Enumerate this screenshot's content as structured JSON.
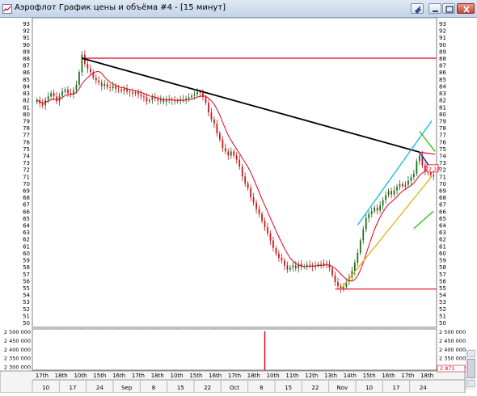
{
  "window": {
    "title": "Аэрофлот График цены и объёма #4 - [15 минут]"
  },
  "colors": {
    "candle_up": "#1a6b1a",
    "candle_down": "#c81414",
    "moving_average": "#e0001c",
    "trendline_black": "#000000",
    "resistance_red": "#e0001c",
    "channel_cyan": "#12b8d8",
    "trend_orange": "#e3b017",
    "fan_blue": "#1632c8",
    "fan_green": "#3bc01e",
    "volume_bar": "#e0001c",
    "grid": "#b4b4b4"
  },
  "chart_data": [
    {
      "type": "candlestick",
      "name": "price",
      "y_ticks": [
        "50",
        "51",
        "52",
        "53",
        "54",
        "55",
        "56",
        "57",
        "58",
        "59",
        "60",
        "61",
        "62",
        "63",
        "64",
        "65",
        "66",
        "67",
        "68",
        "69",
        "70",
        "71",
        "72",
        "73",
        "74",
        "75",
        "76",
        "77",
        "78",
        "79",
        "80",
        "81",
        "82",
        "83",
        "84",
        "85",
        "86",
        "87",
        "88",
        "89",
        "90",
        "91",
        "92",
        "93"
      ],
      "ylim": [
        50,
        93
      ],
      "x_top_labels": [
        "17th",
        "18th",
        "10th",
        "15th",
        "16th",
        "17th",
        "18th",
        "10th",
        "15th",
        "16th",
        "17th",
        "18th",
        "10th",
        "11th",
        "12th",
        "13th",
        "14th",
        "15th",
        "16th",
        "17th",
        "18th"
      ],
      "x_bottom_labels": [
        "10",
        "17",
        "24",
        "Sep",
        "8",
        "15",
        "22",
        "Oct",
        "8",
        "15",
        "22",
        "Nov",
        "10",
        "17",
        "24"
      ],
      "close_series": [
        82.0,
        81.5,
        81.2,
        82.0,
        82.5,
        83.0,
        82.5,
        81.8,
        82.6,
        83.2,
        83.5,
        83.0,
        82.8,
        83.4,
        84.2,
        86.0,
        88.5,
        87.2,
        86.5,
        86.0,
        85.2,
        84.8,
        84.5,
        84.0,
        84.3,
        83.8,
        83.7,
        84.0,
        83.6,
        83.5,
        83.3,
        83.6,
        83.2,
        83.1,
        82.9,
        83.1,
        82.8,
        82.5,
        82.4,
        81.8,
        82.0,
        82.4,
        82.2,
        81.9,
        82.1,
        81.7,
        82.1,
        81.9,
        82.0,
        81.8,
        81.9,
        82.1,
        82.0,
        82.2,
        82.4,
        82.6,
        82.8,
        83.1,
        83.0,
        82.4,
        81.6,
        80.2,
        79.2,
        78.6,
        77.2,
        76.3,
        75.1,
        74.6,
        74.0,
        74.6,
        74.0,
        73.4,
        72.4,
        71.0,
        70.0,
        69.3,
        68.0,
        67.2,
        66.3,
        65.6,
        64.6,
        63.7,
        62.8,
        61.8,
        60.7,
        59.9,
        59.3,
        58.9,
        58.2,
        57.6,
        57.9,
        58.2,
        57.8,
        58.4,
        58.0,
        58.1,
        58.3,
        58.2,
        58.0,
        58.2,
        58.4,
        58.3,
        58.5,
        58.4,
        57.8,
        56.8,
        55.8,
        55.2,
        54.9,
        55.1,
        55.9,
        56.5,
        57.4,
        58.6,
        60.0,
        61.8,
        63.4,
        65.0,
        65.6,
        66.0,
        66.5,
        66.1,
        66.8,
        67.6,
        68.3,
        68.9,
        68.4,
        69.0,
        69.5,
        69.9,
        69.6,
        69.8,
        70.4,
        70.9,
        71.4,
        73.2,
        74.0,
        72.6,
        71.8,
        71.6,
        71.2,
        71.0
      ],
      "last_price": "72.10",
      "moving_average": true,
      "annotations": {
        "resistance_level": 88,
        "support_level": 54.8,
        "downtrend_line": {
          "from": 88.0,
          "to": 74.5
        },
        "uptrend_line": {
          "from": 54.8,
          "to": 71.0
        },
        "channel_line": {
          "from": 64.0,
          "to": 79.0
        }
      }
    },
    {
      "type": "bar",
      "name": "volume",
      "y_ticks": [
        "2 500 000",
        "2 450 000",
        "2 400 000",
        "2 350 000",
        "2 300 000"
      ],
      "ylim": [
        2280000,
        2500000
      ],
      "spike_value": 2500000,
      "last_value": "2 871"
    }
  ]
}
